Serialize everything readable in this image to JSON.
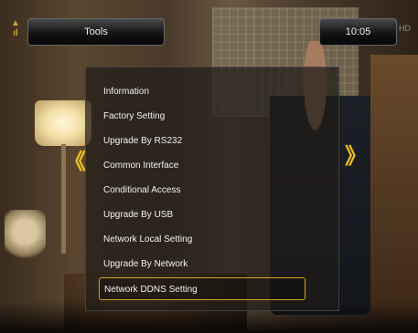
{
  "header": {
    "title": "Tools",
    "time": "10:05",
    "logo_icon": "antenna-logo-icon",
    "corner_mark": "HD"
  },
  "menu": {
    "items": [
      {
        "label": "Information"
      },
      {
        "label": "Factory Setting"
      },
      {
        "label": "Upgrade By RS232"
      },
      {
        "label": "Common Interface"
      },
      {
        "label": "Conditional Access"
      },
      {
        "label": "Upgrade By USB"
      },
      {
        "label": "Network Local Setting"
      },
      {
        "label": "Upgrade By Network"
      },
      {
        "label": "Network DDNS Setting"
      }
    ],
    "selected_index": 8,
    "left_arrow": "《",
    "right_arrow": "》"
  },
  "colors": {
    "accent": "#f3c21e",
    "selection_border": "#d2a520",
    "text": "#f2f2f2"
  }
}
